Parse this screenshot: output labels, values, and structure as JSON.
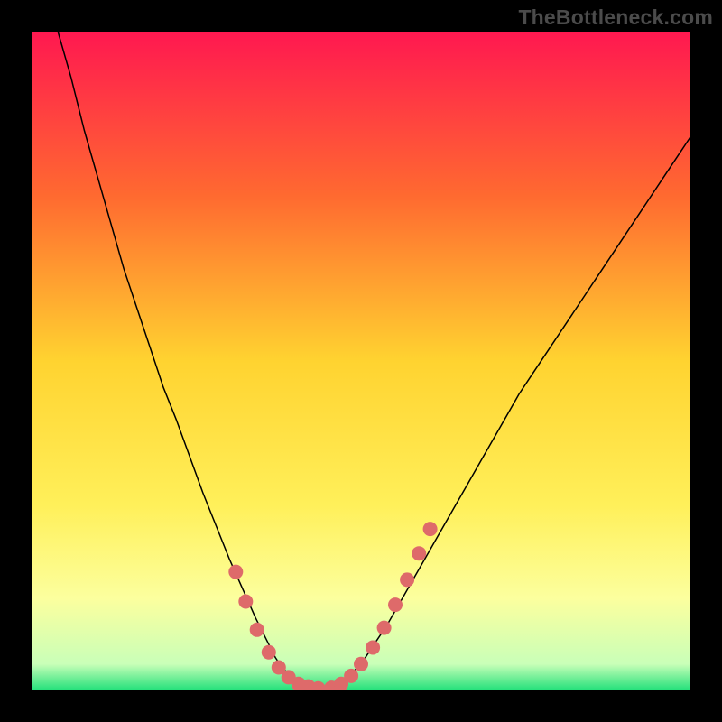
{
  "watermark": "TheBottleneck.com",
  "colors": {
    "background_frame": "#000000",
    "watermark_text": "#4b4b4b",
    "curve_stroke": "#000000",
    "dot_fill": "#de6a6a",
    "gradient_stops": [
      {
        "offset": "0%",
        "color": "#ff1850"
      },
      {
        "offset": "25%",
        "color": "#ff6a30"
      },
      {
        "offset": "50%",
        "color": "#ffd330"
      },
      {
        "offset": "72%",
        "color": "#fff05a"
      },
      {
        "offset": "86%",
        "color": "#fcff9e"
      },
      {
        "offset": "96%",
        "color": "#c9ffb8"
      },
      {
        "offset": "100%",
        "color": "#22e07a"
      }
    ]
  },
  "chart_data": {
    "type": "line",
    "title": "",
    "xlabel": "",
    "ylabel": "",
    "xlim": [
      0,
      100
    ],
    "ylim": [
      0,
      100
    ],
    "x": [
      0,
      2,
      4,
      6,
      8,
      10,
      12,
      14,
      16,
      18,
      20,
      22,
      24,
      26,
      28,
      30,
      32,
      34,
      35,
      36,
      37,
      38,
      40,
      42,
      44,
      46,
      48,
      50,
      52,
      54,
      56,
      58,
      60,
      62,
      64,
      66,
      68,
      70,
      72,
      74,
      76,
      78,
      80,
      82,
      84,
      86,
      88,
      90,
      92,
      94,
      96,
      98,
      100
    ],
    "values": [
      120,
      110,
      101,
      93,
      85,
      78,
      71,
      64,
      58,
      52,
      46,
      41,
      35.5,
      30,
      25,
      20,
      15.5,
      11,
      9,
      7,
      5,
      3.5,
      1.5,
      0.5,
      0,
      0.5,
      2,
      4,
      7,
      10,
      13.5,
      17,
      20.5,
      24,
      27.5,
      31,
      34.5,
      38,
      41.5,
      45,
      48,
      51,
      54,
      57,
      60,
      63,
      66,
      69,
      72,
      75,
      78,
      81,
      84
    ],
    "dots_left": [
      {
        "x": 31,
        "y": 18
      },
      {
        "x": 32.5,
        "y": 13.5
      },
      {
        "x": 34.2,
        "y": 9.2
      },
      {
        "x": 36,
        "y": 5.8
      },
      {
        "x": 37.5,
        "y": 3.5
      },
      {
        "x": 39,
        "y": 2
      },
      {
        "x": 40.5,
        "y": 1
      },
      {
        "x": 42,
        "y": 0.6
      },
      {
        "x": 43.5,
        "y": 0.3
      }
    ],
    "dots_right": [
      {
        "x": 45.5,
        "y": 0.4
      },
      {
        "x": 47,
        "y": 1
      },
      {
        "x": 48.5,
        "y": 2.2
      },
      {
        "x": 50,
        "y": 4
      },
      {
        "x": 51.8,
        "y": 6.5
      },
      {
        "x": 53.5,
        "y": 9.5
      },
      {
        "x": 55.2,
        "y": 13
      },
      {
        "x": 57,
        "y": 16.8
      },
      {
        "x": 58.8,
        "y": 20.8
      },
      {
        "x": 60.5,
        "y": 24.5
      }
    ],
    "dot_radius_px": 8
  }
}
